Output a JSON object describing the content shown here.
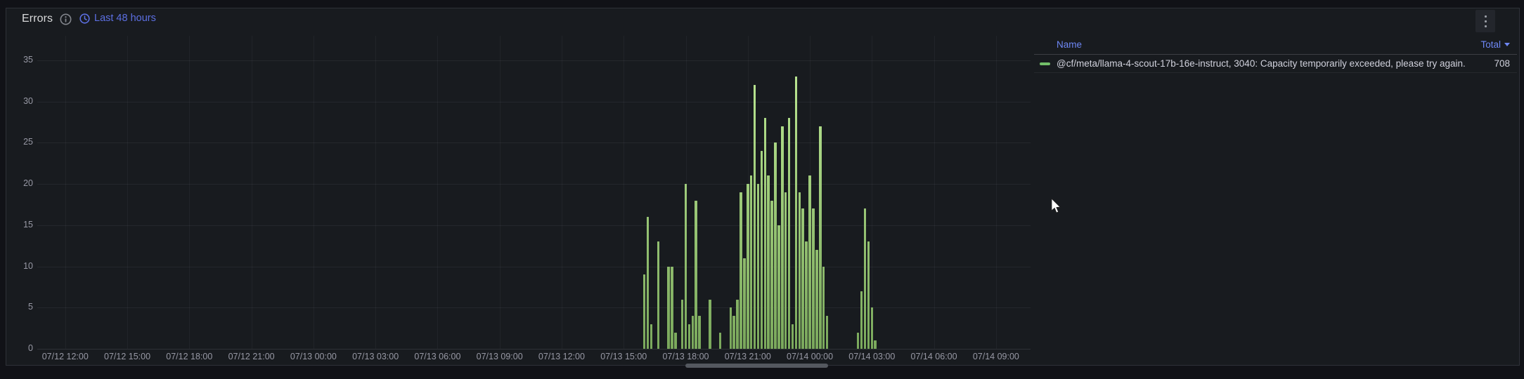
{
  "panel": {
    "title": "Errors",
    "time_range_label": "Last 48 hours",
    "icons": {
      "info": "info-circle-icon",
      "clock": "clock-icon",
      "menu": "kebab-menu-icon"
    },
    "colors": {
      "time_link": "#5c6fe2",
      "header_link": "#6e87f5",
      "title": "#d8d9da"
    }
  },
  "legend": {
    "name_header": "Name",
    "total_header": "Total",
    "sorted_by": "Total",
    "sort_direction": "desc",
    "rows": [
      {
        "name": "@cf/meta/llama-4-scout-17b-16e-instruct, 3040: Capacity temporarily exceeded, please try again.",
        "total": "708",
        "swatch_color": "#73bf69"
      }
    ]
  },
  "chart_data": {
    "type": "bar",
    "title": "Errors",
    "xlabel": "",
    "ylabel": "",
    "x_range": [
      "07/12 10:45",
      "07/14 10:30"
    ],
    "ylim": [
      0,
      38
    ],
    "grid": true,
    "legend_position": "right-table",
    "bucket_minutes": 10,
    "y_ticks": [
      0,
      5,
      10,
      15,
      20,
      25,
      30,
      35
    ],
    "x_ticks": [
      "07/12 12:00",
      "07/12 15:00",
      "07/12 18:00",
      "07/12 21:00",
      "07/13 00:00",
      "07/13 03:00",
      "07/13 06:00",
      "07/13 09:00",
      "07/13 12:00",
      "07/13 15:00",
      "07/13 18:00",
      "07/13 21:00",
      "07/14 00:00",
      "07/14 03:00",
      "07/14 06:00",
      "07/14 09:00"
    ],
    "series": [
      {
        "name": "@cf/meta/llama-4-scout-17b-16e-instruct, 3040: Capacity temporarily exceeded, please try again.",
        "total": 708,
        "color_bottom": "#7aa85c",
        "color_top": "#c2ee98",
        "points": [
          [
            "07/13 16:00",
            9
          ],
          [
            "07/13 16:10",
            16
          ],
          [
            "07/13 16:20",
            3
          ],
          [
            "07/13 16:40",
            13
          ],
          [
            "07/13 17:10",
            10
          ],
          [
            "07/13 17:20",
            10
          ],
          [
            "07/13 17:30",
            2
          ],
          [
            "07/13 17:50",
            6
          ],
          [
            "07/13 18:00",
            20
          ],
          [
            "07/13 18:10",
            3
          ],
          [
            "07/13 18:20",
            4
          ],
          [
            "07/13 18:30",
            18
          ],
          [
            "07/13 18:40",
            4
          ],
          [
            "07/13 19:10",
            6
          ],
          [
            "07/13 19:40",
            2
          ],
          [
            "07/13 20:10",
            5
          ],
          [
            "07/13 20:20",
            4
          ],
          [
            "07/13 20:30",
            6
          ],
          [
            "07/13 20:40",
            19
          ],
          [
            "07/13 20:50",
            11
          ],
          [
            "07/13 21:00",
            20
          ],
          [
            "07/13 21:10",
            21
          ],
          [
            "07/13 21:20",
            32
          ],
          [
            "07/13 21:30",
            20
          ],
          [
            "07/13 21:40",
            24
          ],
          [
            "07/13 21:50",
            28
          ],
          [
            "07/13 22:00",
            21
          ],
          [
            "07/13 22:10",
            18
          ],
          [
            "07/13 22:20",
            25
          ],
          [
            "07/13 22:30",
            15
          ],
          [
            "07/13 22:40",
            27
          ],
          [
            "07/13 22:50",
            19
          ],
          [
            "07/13 23:00",
            28
          ],
          [
            "07/13 23:10",
            3
          ],
          [
            "07/13 23:20",
            33
          ],
          [
            "07/13 23:30",
            19
          ],
          [
            "07/13 23:40",
            17
          ],
          [
            "07/13 23:50",
            13
          ],
          [
            "07/14 00:00",
            21
          ],
          [
            "07/14 00:10",
            17
          ],
          [
            "07/14 00:20",
            12
          ],
          [
            "07/14 00:30",
            27
          ],
          [
            "07/14 00:40",
            10
          ],
          [
            "07/14 00:50",
            4
          ],
          [
            "07/14 02:20",
            2
          ],
          [
            "07/14 02:30",
            7
          ],
          [
            "07/14 02:40",
            17
          ],
          [
            "07/14 02:50",
            13
          ],
          [
            "07/14 03:00",
            5
          ],
          [
            "07/14 03:10",
            1
          ]
        ]
      }
    ]
  }
}
